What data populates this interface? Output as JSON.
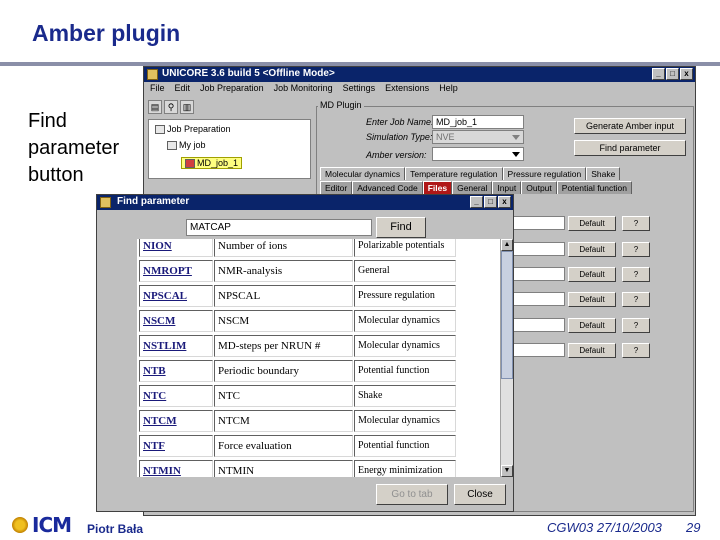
{
  "slide": {
    "title": "Amber plugin",
    "side_label": "Find parameter button",
    "footer": {
      "logo_text": "ICM",
      "author": "Piotr Bała",
      "event": "CGW03 27/10/2003",
      "page": "29"
    }
  },
  "main_window": {
    "title": "UNICORE 3.6 build 5 <Offline Mode>",
    "menu": [
      "File",
      "Edit",
      "Job Preparation",
      "Job Monitoring",
      "Settings",
      "Extensions",
      "Help"
    ],
    "tree": {
      "root": "Job Preparation",
      "job": "My job",
      "subjob": "MD_job_1"
    },
    "plugin_label": "MD Plugin",
    "form": {
      "job_name_label": "Enter Job Name:",
      "job_name_value": "MD_job_1",
      "sim_type_label": "Simulation Type:",
      "sim_type_value": "NVE",
      "amber_version_label": "Amber version:",
      "amber_version_value": ""
    },
    "buttons": {
      "generate": "Generate Amber input",
      "find_param": "Find parameter"
    },
    "tabs_top": [
      "Molecular dynamics",
      "Temperature regulation",
      "Pressure regulation",
      "Shake"
    ],
    "tabs_bottom": [
      "Editor",
      "Advanced Code",
      "Files",
      "General",
      "Input",
      "Output",
      "Potential function"
    ],
    "right_rows": [
      {
        "default": "Default",
        "help": "?"
      },
      {
        "default": "Default",
        "help": "?"
      },
      {
        "default": "Default",
        "help": "?"
      },
      {
        "default": "Default",
        "help": "?"
      },
      {
        "default": "Default",
        "help": "?"
      },
      {
        "default": "Default",
        "help": "?"
      }
    ]
  },
  "find_dialog": {
    "title": "Find parameter",
    "search_value": "MATCAP",
    "find_label": "Find",
    "rows": [
      {
        "name": "NION",
        "desc": "Number of ions",
        "cat": "Polarizable potentials"
      },
      {
        "name": "NMROPT",
        "desc": "NMR-analysis",
        "cat": "General"
      },
      {
        "name": "NPSCAL",
        "desc": "NPSCAL",
        "cat": "Pressure regulation"
      },
      {
        "name": "NSCM",
        "desc": "NSCM",
        "cat": "Molecular dynamics"
      },
      {
        "name": "NSTLIM",
        "desc": "MD-steps per NRUN #",
        "cat": "Molecular dynamics"
      },
      {
        "name": "NTB",
        "desc": "Periodic boundary",
        "cat": "Potential function"
      },
      {
        "name": "NTC",
        "desc": "NTC",
        "cat": "Shake"
      },
      {
        "name": "NTCM",
        "desc": "NTCM",
        "cat": "Molecular dynamics"
      },
      {
        "name": "NTF",
        "desc": "Force evaluation",
        "cat": "Potential function"
      },
      {
        "name": "NTMIN",
        "desc": "NTMIN",
        "cat": "Energy minimization"
      }
    ],
    "goto_label": "Go to tab",
    "close_label": "Close"
  }
}
